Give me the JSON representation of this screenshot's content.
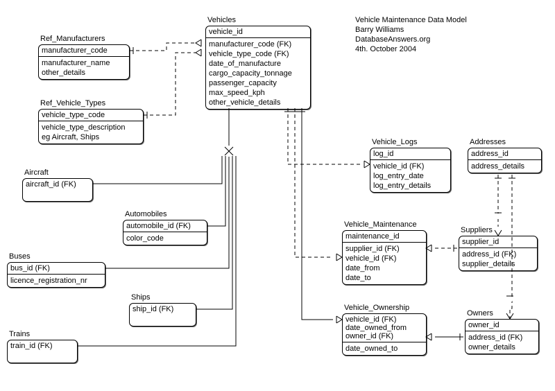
{
  "meta": {
    "title": "Vehicle Maintenance Data Model",
    "author": "Barry Williams",
    "site": "DatabaseAnswers.org",
    "date": "4th. October 2004"
  },
  "entities": {
    "ref_manufacturers": {
      "title": "Ref_Manufacturers",
      "pk": [
        "manufacturer_code"
      ],
      "attrs": [
        "manufacturer_name",
        "other_details"
      ]
    },
    "ref_vehicle_types": {
      "title": "Ref_Vehicle_Types",
      "pk": [
        "vehicle_type_code"
      ],
      "attrs": [
        "vehicle_type_description",
        "eg Aircraft, Ships"
      ]
    },
    "vehicles": {
      "title": "Vehicles",
      "pk": [
        "vehicle_id"
      ],
      "attrs": [
        "manufacturer_code (FK)",
        "vehicle_type_code (FK)",
        "date_of_manufacture",
        "cargo_capacity_tonnage",
        "passenger_capacity",
        "max_speed_kph",
        "other_vehicle_details"
      ]
    },
    "aircraft": {
      "title": "Aircraft",
      "pk": [
        "aircraft_id (FK)"
      ],
      "attrs": []
    },
    "automobiles": {
      "title": "Automobiles",
      "pk": [
        "automobile_id (FK)"
      ],
      "attrs": [
        "color_code"
      ]
    },
    "buses": {
      "title": "Buses",
      "pk": [
        "bus_id (FK)"
      ],
      "attrs": [
        "licence_registration_nr"
      ]
    },
    "ships": {
      "title": "Ships",
      "pk": [
        "ship_id (FK)"
      ],
      "attrs": []
    },
    "trains": {
      "title": "Trains",
      "pk": [
        "train_id (FK)"
      ],
      "attrs": []
    },
    "vehicle_logs": {
      "title": "Vehicle_Logs",
      "pk": [
        "log_id"
      ],
      "attrs": [
        "vehicle_id (FK)",
        "log_entry_date",
        "log_entry_details"
      ]
    },
    "addresses": {
      "title": "Addresses",
      "pk": [
        "address_id"
      ],
      "attrs": [
        "address_details"
      ]
    },
    "vehicle_maintenance": {
      "title": "Vehicle_Maintenance",
      "pk": [
        "maintenance_id"
      ],
      "attrs": [
        "supplier_id (FK)",
        "vehicle_id (FK)",
        "date_from",
        "date_to"
      ]
    },
    "suppliers": {
      "title": "Suppliers",
      "pk": [
        "supplier_id"
      ],
      "attrs": [
        "address_id (FK)",
        "supplier_details"
      ]
    },
    "vehicle_ownership": {
      "title": "Vehicle_Ownership",
      "pk": [
        "vehicle_id (FK)",
        "date_owned_from",
        "owner_id (FK)"
      ],
      "attrs": [
        "date_owned_to"
      ]
    },
    "owners": {
      "title": "Owners",
      "pk": [
        "owner_id"
      ],
      "attrs": [
        "address_id (FK)",
        "owner_details"
      ]
    }
  },
  "relationships": [
    {
      "from": "vehicles.manufacturer_code",
      "to": "ref_manufacturers.manufacturer_code",
      "type": "many-to-one",
      "identifying": false
    },
    {
      "from": "vehicles.vehicle_type_code",
      "to": "ref_vehicle_types.vehicle_type_code",
      "type": "many-to-one",
      "identifying": false
    },
    {
      "from": "aircraft",
      "to": "vehicles",
      "type": "subtype"
    },
    {
      "from": "automobiles",
      "to": "vehicles",
      "type": "subtype"
    },
    {
      "from": "buses",
      "to": "vehicles",
      "type": "subtype"
    },
    {
      "from": "ships",
      "to": "vehicles",
      "type": "subtype"
    },
    {
      "from": "trains",
      "to": "vehicles",
      "type": "subtype"
    },
    {
      "from": "vehicle_logs.vehicle_id",
      "to": "vehicles.vehicle_id",
      "type": "many-to-one",
      "identifying": false
    },
    {
      "from": "vehicle_maintenance.vehicle_id",
      "to": "vehicles.vehicle_id",
      "type": "many-to-one",
      "identifying": false
    },
    {
      "from": "vehicle_maintenance.supplier_id",
      "to": "suppliers.supplier_id",
      "type": "many-to-one",
      "identifying": false
    },
    {
      "from": "vehicle_ownership.vehicle_id",
      "to": "vehicles.vehicle_id",
      "type": "many-to-one",
      "identifying": true
    },
    {
      "from": "vehicle_ownership.owner_id",
      "to": "owners.owner_id",
      "type": "many-to-one",
      "identifying": true
    },
    {
      "from": "suppliers.address_id",
      "to": "addresses.address_id",
      "type": "many-to-one",
      "identifying": false
    },
    {
      "from": "owners.address_id",
      "to": "addresses.address_id",
      "type": "many-to-one",
      "identifying": false
    }
  ]
}
